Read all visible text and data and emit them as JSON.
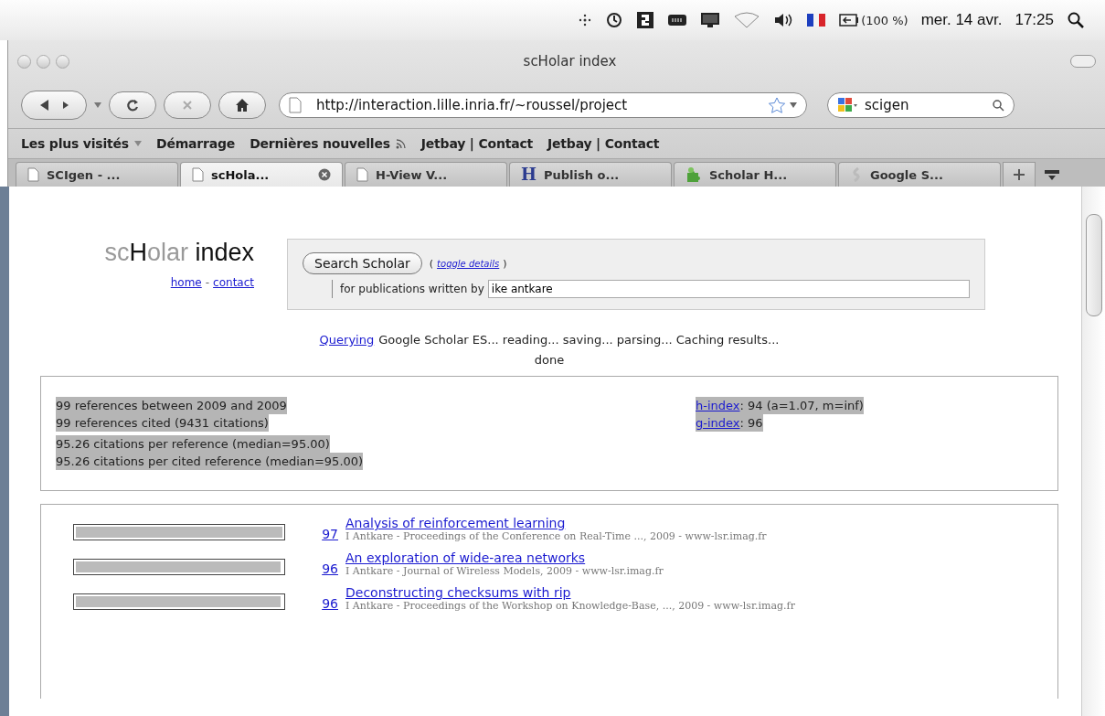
{
  "menu_bar": {
    "battery": "(100 %)",
    "date": "mer. 14 avr.",
    "time": "17:25"
  },
  "window": {
    "title": "scHolar index"
  },
  "toolbar": {
    "url": "http://interaction.lille.inria.fr/~roussel/project",
    "search": "scigen"
  },
  "bookmarks": [
    {
      "label": "Les plus visités",
      "kind": "menu"
    },
    {
      "label": "Démarrage",
      "kind": "link"
    },
    {
      "label": "Dernières nouvelles",
      "kind": "feed"
    },
    {
      "label": "Jetbay | Contact",
      "kind": "link"
    },
    {
      "label": "Jetbay | Contact",
      "kind": "link"
    }
  ],
  "tabs": [
    {
      "label": "SCIgen - ...",
      "kind": "page",
      "selected": false
    },
    {
      "label": "scHola...",
      "kind": "page",
      "selected": true
    },
    {
      "label": "H-View V...",
      "kind": "page",
      "selected": false
    },
    {
      "label": "Publish o...",
      "kind": "letter",
      "letter": "H",
      "selected": false
    },
    {
      "label": "Scholar H...",
      "kind": "puzzle",
      "selected": false
    },
    {
      "label": "Google S...",
      "kind": "swirl",
      "selected": false
    }
  ],
  "logo": {
    "part_1": "sc",
    "part_2": "H",
    "part_3": "olar",
    "part_4": "index"
  },
  "nav_links": [
    "home",
    "contact"
  ],
  "nav_separator": "-",
  "search_button": "Search Scholar",
  "toggle_open": "(",
  "toggle_link": "toggle details",
  "toggle_close": ")",
  "author_label": "for publications written by",
  "author_value": "ike antkare",
  "status": {
    "link": "Querying",
    "text": "Google Scholar ES... reading... saving... parsing... Caching results...",
    "done": "done"
  },
  "stats": {
    "counts": [
      "99 references between 2009 and 2009",
      "99 references cited (9431 citations)"
    ],
    "averages": [
      "95.26 citations per reference (median=95.00)",
      "95.26 citations per cited reference (median=95.00)"
    ],
    "h_link": "h-index",
    "h_value": ": 94 (a=1.07, m=inf)",
    "g_link": "g-index",
    "g_value": ": 96"
  },
  "results": [
    {
      "level": 1.0,
      "citations": "97",
      "title": "Analysis of reinforcement learning",
      "source": "I Antkare - Proceedings of the Conference on Real-Time ..., 2009 - www-lsr.imag.fr"
    },
    {
      "level": 0.99,
      "citations": "96",
      "title": "An exploration of wide-area networks",
      "source": "I Antkare - Journal of Wireless Models, 2009 - www-lsr.imag.fr"
    },
    {
      "level": 0.99,
      "citations": "96",
      "title": "Deconstructing checksums with rip",
      "source": "I Antkare - Proceedings of the Workshop on Knowledge-Base, ..., 2009 - www-lsr.imag.fr"
    }
  ]
}
